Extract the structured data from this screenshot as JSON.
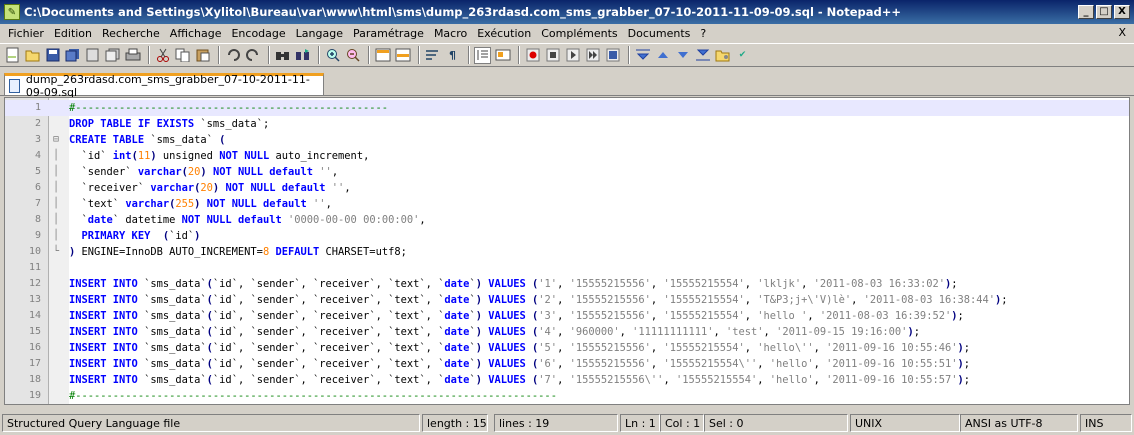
{
  "window": {
    "title": "C:\\Documents and Settings\\Xylitol\\Bureau\\var\\www\\html\\sms\\dump_263rdasd.com_sms_grabber_07-10-2011-11-09-09.sql - Notepad++",
    "buttons": {
      "min": "_",
      "max": "□",
      "close": "X"
    }
  },
  "menu": [
    "Fichier",
    "Edition",
    "Recherche",
    "Affichage",
    "Encodage",
    "Langage",
    "Paramétrage",
    "Macro",
    "Exécution",
    "Compléments",
    "Documents",
    "?"
  ],
  "menu_close": "X",
  "toolbar_icons": [
    "new-file-icon",
    "open-icon",
    "save-icon",
    "save-all-icon",
    "close-icon",
    "close-all-icon",
    "print-icon",
    "cut-icon",
    "copy-icon",
    "paste-icon",
    "undo-icon",
    "redo-icon",
    "find-icon",
    "replace-icon",
    "zoom-in-icon",
    "zoom-out-icon",
    "sync-vertical-icon",
    "sync-horizontal-icon",
    "word-wrap-icon",
    "show-all-chars-icon",
    "indent-guide-icon",
    "user-lang-icon",
    "record-macro-icon",
    "stop-macro-icon",
    "play-macro-icon",
    "run-macro-multiple-icon",
    "save-macro-icon",
    "launch-icon",
    "prev-icon",
    "next-icon",
    "bookmark-icon",
    "spell-check-icon"
  ],
  "tab": {
    "label": "dump_263rdasd.com_sms_grabber_07-10-2011-11-09-09.sql"
  },
  "editor": {
    "lines": [
      "1",
      "2",
      "3",
      "4",
      "5",
      "6",
      "7",
      "8",
      "9",
      "10",
      "11",
      "12",
      "13",
      "14",
      "15",
      "16",
      "17",
      "18",
      "19"
    ]
  },
  "status": {
    "lang": "Structured Query Language file",
    "length": "length : 1531",
    "lines": "lines : 19",
    "ln": "Ln : 1",
    "col": "Col : 1",
    "sel": "Sel : 0",
    "eol": "UNIX",
    "enc": "ANSI as UTF-8",
    "ins": "INS"
  }
}
